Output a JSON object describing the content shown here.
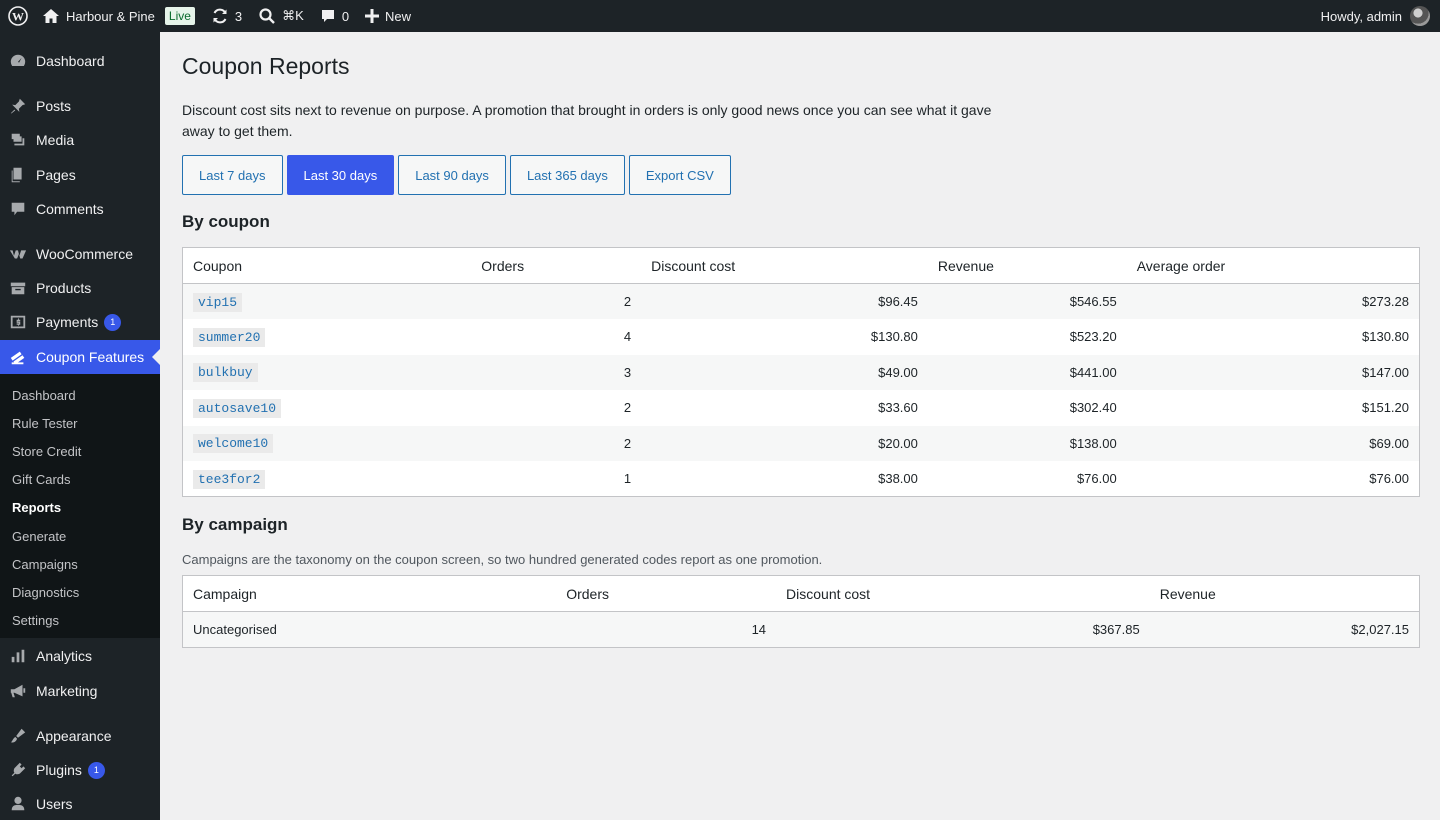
{
  "adminbar": {
    "site_name": "Harbour & Pine",
    "live_badge": "Live",
    "updates_count": "3",
    "search_shortcut": "⌘K",
    "comments_count": "0",
    "new_label": "New",
    "greeting": "Howdy, admin"
  },
  "sidebar": {
    "items": [
      {
        "label": "Dashboard",
        "icon": "dashboard-icon"
      },
      {
        "label": "Posts",
        "icon": "pin-icon"
      },
      {
        "label": "Media",
        "icon": "media-icon"
      },
      {
        "label": "Pages",
        "icon": "pages-icon"
      },
      {
        "label": "Comments",
        "icon": "comment-icon"
      },
      {
        "label": "WooCommerce",
        "icon": "woo-icon"
      },
      {
        "label": "Products",
        "icon": "archive-icon"
      },
      {
        "label": "Payments",
        "icon": "payments-icon",
        "badge": "1"
      },
      {
        "label": "Coupon Features",
        "icon": "ticket-icon"
      },
      {
        "label": "Analytics",
        "icon": "chart-icon"
      },
      {
        "label": "Marketing",
        "icon": "megaphone-icon"
      },
      {
        "label": "Appearance",
        "icon": "brush-icon"
      },
      {
        "label": "Plugins",
        "icon": "plugin-icon",
        "badge": "1"
      },
      {
        "label": "Users",
        "icon": "user-icon"
      }
    ],
    "submenu": [
      "Dashboard",
      "Rule Tester",
      "Store Credit",
      "Gift Cards",
      "Reports",
      "Generate",
      "Campaigns",
      "Diagnostics",
      "Settings"
    ],
    "submenu_current": "Reports"
  },
  "page": {
    "title": "Coupon Reports",
    "intro": "Discount cost sits next to revenue on purpose. A promotion that brought in orders is only good news once you can see what it gave away to get them.",
    "filters": [
      {
        "label": "Last 7 days",
        "active": false
      },
      {
        "label": "Last 30 days",
        "active": true
      },
      {
        "label": "Last 90 days",
        "active": false
      },
      {
        "label": "Last 365 days",
        "active": false
      },
      {
        "label": "Export CSV",
        "active": false
      }
    ]
  },
  "by_coupon": {
    "heading": "By coupon",
    "columns": [
      "Coupon",
      "Orders",
      "Discount cost",
      "Revenue",
      "Average order"
    ],
    "rows": [
      {
        "coupon": "vip15",
        "orders": "2",
        "discount": "$96.45",
        "revenue": "$546.55",
        "average": "$273.28"
      },
      {
        "coupon": "summer20",
        "orders": "4",
        "discount": "$130.80",
        "revenue": "$523.20",
        "average": "$130.80"
      },
      {
        "coupon": "bulkbuy",
        "orders": "3",
        "discount": "$49.00",
        "revenue": "$441.00",
        "average": "$147.00"
      },
      {
        "coupon": "autosave10",
        "orders": "2",
        "discount": "$33.60",
        "revenue": "$302.40",
        "average": "$151.20"
      },
      {
        "coupon": "welcome10",
        "orders": "2",
        "discount": "$20.00",
        "revenue": "$138.00",
        "average": "$69.00"
      },
      {
        "coupon": "tee3for2",
        "orders": "1",
        "discount": "$38.00",
        "revenue": "$76.00",
        "average": "$76.00"
      }
    ]
  },
  "by_campaign": {
    "heading": "By campaign",
    "description": "Campaigns are the taxonomy on the coupon screen, so two hundred generated codes report as one promotion.",
    "columns": [
      "Campaign",
      "Orders",
      "Discount cost",
      "Revenue"
    ],
    "rows": [
      {
        "campaign": "Uncategorised",
        "orders": "14",
        "discount": "$367.85",
        "revenue": "$2,027.15"
      }
    ]
  }
}
